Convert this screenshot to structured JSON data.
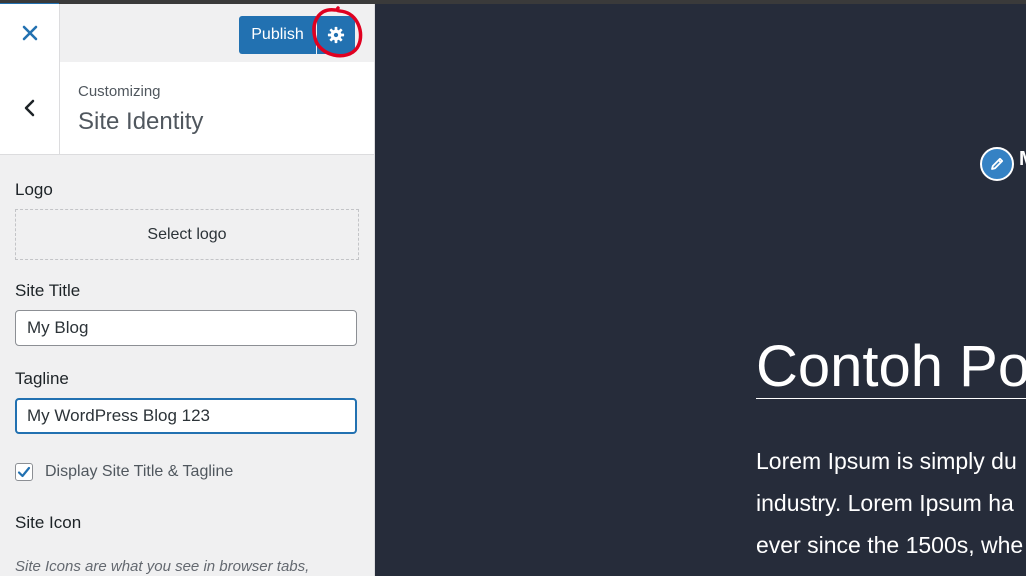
{
  "header": {
    "close_icon": "close-icon",
    "publish_label": "Publish",
    "settings_icon": "gear-icon"
  },
  "section": {
    "back_icon": "chevron-left-icon",
    "crumb": "Customizing",
    "title": "Site Identity"
  },
  "logo": {
    "label": "Logo",
    "button_label": "Select logo"
  },
  "site_title": {
    "label": "Site Title",
    "value": "My Blog"
  },
  "tagline": {
    "label": "Tagline",
    "value": "My WordPress Blog 123"
  },
  "display_checkbox": {
    "label": "Display Site Title & Tagline",
    "checked": true
  },
  "site_icon": {
    "label": "Site Icon",
    "description": "Site Icons are what you see in browser tabs,"
  },
  "preview": {
    "site_title_partial": "M",
    "post_title": "Contoh Po",
    "paragraph_lines": [
      "Lorem Ipsum is simply du",
      "industry. Lorem Ipsum ha",
      "ever since the 1500s, whe"
    ]
  },
  "colors": {
    "accent": "#2271b1",
    "sidebar_bg": "#f0f0f1",
    "preview_bg": "#262c3a",
    "annotation": "#e00020"
  }
}
